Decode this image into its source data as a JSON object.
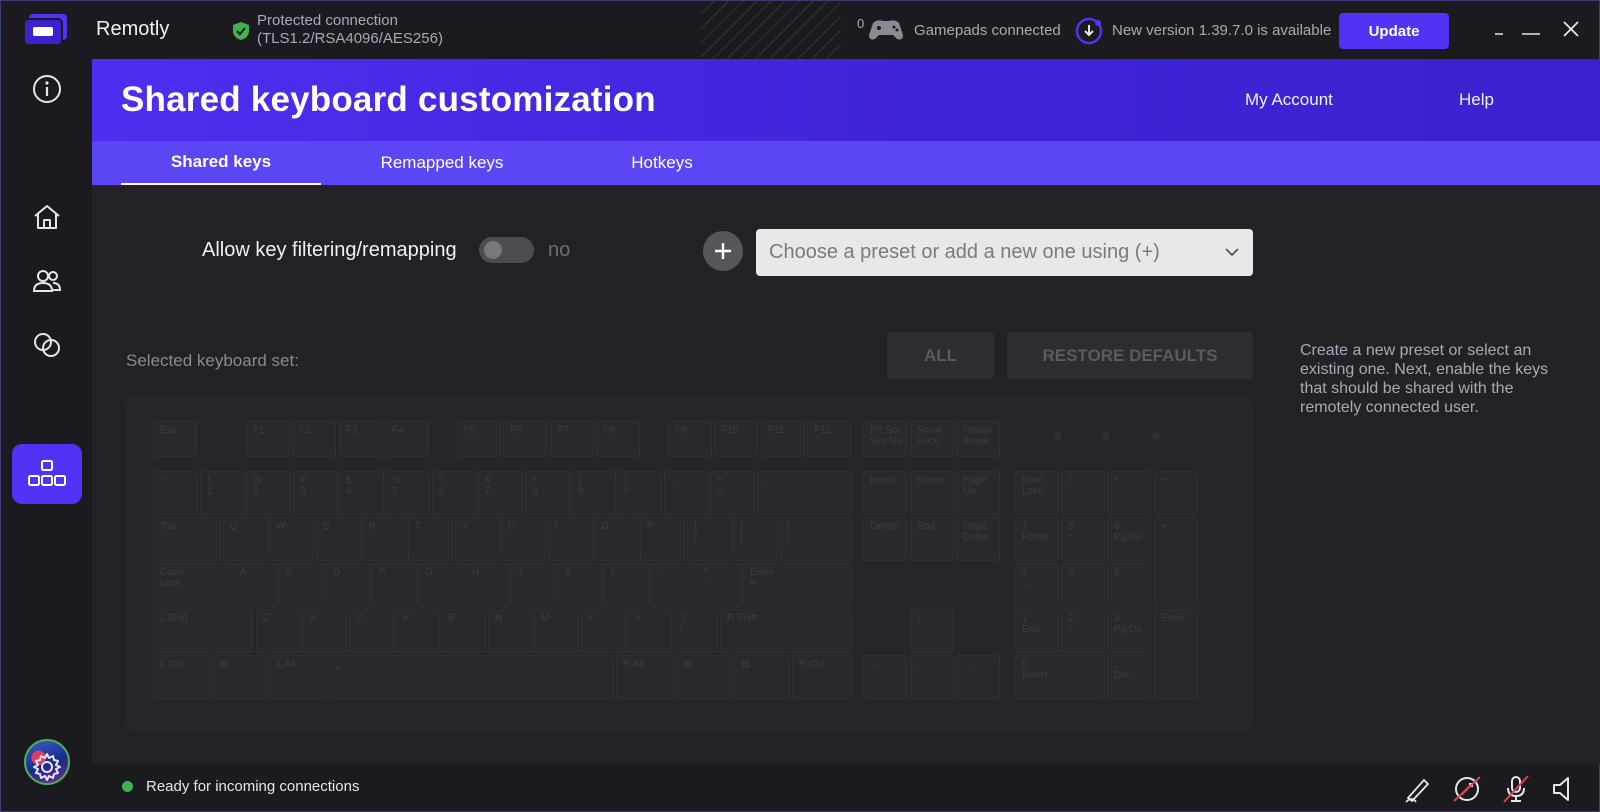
{
  "app": {
    "name": "Remotly"
  },
  "connection": {
    "line1": "Protected connection",
    "line2": "(TLS1.2/RSA4096/AES256)"
  },
  "gamepads": {
    "count": "0",
    "label": "Gamepads connected"
  },
  "update": {
    "message": "New version 1.39.7.0 is available",
    "button": "Update"
  },
  "header": {
    "title": "Shared keyboard customization",
    "my_account": "My Account",
    "help": "Help"
  },
  "tabs": [
    {
      "label": "Shared keys"
    },
    {
      "label": "Remapped keys"
    },
    {
      "label": "Hotkeys"
    }
  ],
  "filter": {
    "label": "Allow key filtering/remapping",
    "state": "no"
  },
  "preset": {
    "placeholder": "Choose a preset or add a new one using (+)"
  },
  "keyboard_set": {
    "label": "Selected keyboard set:",
    "all_button": "ALL",
    "restore_button": "RESTORE DEFAULTS"
  },
  "help_text": "Create a new preset or select an existing one. Next, enable the keys that should be shared with the remotely connected user.",
  "status": {
    "text": "Ready for incoming connections"
  },
  "colors": {
    "accent": "#5133f5",
    "status_ok": "#3fb24f",
    "shield": "#3fb24f"
  },
  "keyboard": {
    "function_row": [
      {
        "k": "esc",
        "l": "Esc"
      },
      {
        "k": "f1",
        "l": "F1"
      },
      {
        "k": "f2",
        "l": "F2"
      },
      {
        "k": "f3",
        "l": "F3"
      },
      {
        "k": "f4",
        "l": "F4"
      },
      {
        "k": "f5",
        "l": "F5"
      },
      {
        "k": "f6",
        "l": "F6"
      },
      {
        "k": "f7",
        "l": "F7"
      },
      {
        "k": "f8",
        "l": "F8"
      },
      {
        "k": "f9",
        "l": "F9"
      },
      {
        "k": "f10",
        "l": "F10"
      },
      {
        "k": "f11",
        "l": "F11"
      },
      {
        "k": "f12",
        "l": "F12"
      },
      {
        "k": "prtsc",
        "l": "Prt Scr\nSys Rq"
      },
      {
        "k": "scroll",
        "l": "Scroll\nLock"
      },
      {
        "k": "pause",
        "l": "Pause\nBreak"
      }
    ],
    "number_row": [
      {
        "k": "tilde",
        "l": "~\n`"
      },
      {
        "k": "1",
        "l": "!\n1"
      },
      {
        "k": "2",
        "l": "@\n2"
      },
      {
        "k": "3",
        "l": "#\n3"
      },
      {
        "k": "4",
        "l": "$\n4"
      },
      {
        "k": "5",
        "l": "%\n5"
      },
      {
        "k": "6",
        "l": "^\n6"
      },
      {
        "k": "7",
        "l": "&\n7"
      },
      {
        "k": "8",
        "l": "*\n8"
      },
      {
        "k": "9",
        "l": "(\n9"
      },
      {
        "k": "0",
        "l": ")\n0"
      },
      {
        "k": "minus",
        "l": "_\n-"
      },
      {
        "k": "equal",
        "l": "+\n="
      },
      {
        "k": "backspace",
        "l": "←"
      },
      {
        "k": "insert",
        "l": "Insert"
      },
      {
        "k": "home",
        "l": "Home"
      },
      {
        "k": "pgup",
        "l": "Page\nUp"
      },
      {
        "k": "numlock",
        "l": "Num\nLock"
      },
      {
        "k": "npdiv",
        "l": "/"
      },
      {
        "k": "npmul",
        "l": "*"
      },
      {
        "k": "npsub",
        "l": "−"
      }
    ],
    "qwerty_row": [
      {
        "k": "tab",
        "l": "Tab"
      },
      {
        "k": "q",
        "l": "Q"
      },
      {
        "k": "w",
        "l": "W"
      },
      {
        "k": "e",
        "l": "E"
      },
      {
        "k": "r",
        "l": "R"
      },
      {
        "k": "t",
        "l": "T"
      },
      {
        "k": "y",
        "l": "Y"
      },
      {
        "k": "u",
        "l": "U"
      },
      {
        "k": "i",
        "l": "I"
      },
      {
        "k": "o",
        "l": "O"
      },
      {
        "k": "p",
        "l": "P"
      },
      {
        "k": "lbracket",
        "l": "{\n["
      },
      {
        "k": "rbracket",
        "l": "}\n]"
      },
      {
        "k": "backslash",
        "l": "|\n\\"
      },
      {
        "k": "delete",
        "l": "Delete"
      },
      {
        "k": "end",
        "l": "End"
      },
      {
        "k": "pgdn",
        "l": "Page\nDown"
      },
      {
        "k": "np7",
        "l": "7\nHome"
      },
      {
        "k": "np8",
        "l": "8\n↑"
      },
      {
        "k": "np9",
        "l": "9\nPg Up"
      },
      {
        "k": "npadd",
        "l": "+"
      }
    ],
    "home_row": [
      {
        "k": "caps",
        "l": "Caps\nLock"
      },
      {
        "k": "a",
        "l": "A"
      },
      {
        "k": "s",
        "l": "S"
      },
      {
        "k": "d",
        "l": "D"
      },
      {
        "k": "f",
        "l": "F"
      },
      {
        "k": "g",
        "l": "G"
      },
      {
        "k": "h",
        "l": "H"
      },
      {
        "k": "j",
        "l": "J"
      },
      {
        "k": "k",
        "l": "K"
      },
      {
        "k": "l",
        "l": "L"
      },
      {
        "k": "semicolon",
        "l": ":\n;"
      },
      {
        "k": "quote",
        "l": "\"\n'"
      },
      {
        "k": "enter",
        "l": "Enter\n↵"
      },
      {
        "k": "np4",
        "l": "4\n←"
      },
      {
        "k": "np5",
        "l": "5"
      },
      {
        "k": "np6",
        "l": "6\n→"
      }
    ],
    "shift_row": [
      {
        "k": "lshift",
        "l": "L Shift"
      },
      {
        "k": "z",
        "l": "Z"
      },
      {
        "k": "x",
        "l": "X"
      },
      {
        "k": "c",
        "l": "C"
      },
      {
        "k": "v",
        "l": "V"
      },
      {
        "k": "b",
        "l": "B"
      },
      {
        "k": "n",
        "l": "N"
      },
      {
        "k": "m",
        "l": "M"
      },
      {
        "k": "comma",
        "l": "<\n,"
      },
      {
        "k": "period",
        "l": ">\n."
      },
      {
        "k": "slash",
        "l": "?\n/"
      },
      {
        "k": "rshift",
        "l": "R Shift"
      },
      {
        "k": "up",
        "l": "↑"
      },
      {
        "k": "np1",
        "l": "1\nEnd"
      },
      {
        "k": "np2",
        "l": "2\n↓"
      },
      {
        "k": "np3",
        "l": "3\nPg Dn"
      },
      {
        "k": "npenter",
        "l": "Enter"
      }
    ],
    "bottom_row": [
      {
        "k": "lctrl",
        "l": "L Ctrl"
      },
      {
        "k": "lwin",
        "l": "⊞"
      },
      {
        "k": "lalt",
        "l": "L Alt"
      },
      {
        "k": "space",
        "l": "⎵"
      },
      {
        "k": "ralt",
        "l": "R Alt"
      },
      {
        "k": "rwin",
        "l": "⊞"
      },
      {
        "k": "menu",
        "l": "▤"
      },
      {
        "k": "rctrl",
        "l": "R Ctrl"
      },
      {
        "k": "left",
        "l": "←"
      },
      {
        "k": "down",
        "l": "↓"
      },
      {
        "k": "right",
        "l": "→"
      },
      {
        "k": "np0",
        "l": "0\nInsert"
      },
      {
        "k": "npdec",
        "l": ".\nDel"
      }
    ]
  }
}
